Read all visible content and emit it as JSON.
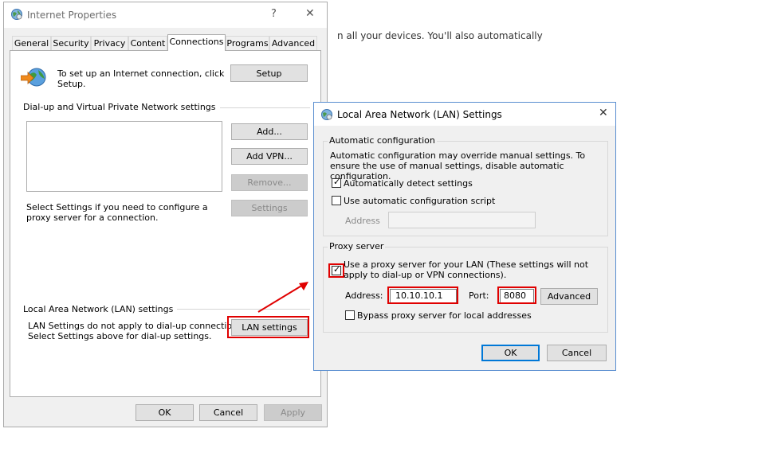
{
  "background": {
    "snippet": "n all your devices. You'll also automatically"
  },
  "internet_properties": {
    "title": "Internet Properties",
    "help_glyph": "?",
    "close_glyph": "✕",
    "tabs": [
      "General",
      "Security",
      "Privacy",
      "Content",
      "Connections",
      "Programs",
      "Advanced"
    ],
    "active_tab": "Connections",
    "setup_text": "To set up an Internet connection, click Setup.",
    "setup_button": "Setup",
    "dialup_group_label": "Dial-up and Virtual Private Network settings",
    "add_button": "Add...",
    "add_vpn_button": "Add VPN...",
    "remove_button": "Remove...",
    "settings_button": "Settings",
    "proxy_hint": "Select Settings if you need to configure a proxy server for a connection.",
    "lan_group_label": "Local Area Network (LAN) settings",
    "lan_note_1": "LAN Settings do not apply to dial-up connections.",
    "lan_note_2": "Select Settings above for dial-up settings.",
    "lan_settings_button": "LAN settings",
    "ok_button": "OK",
    "cancel_button": "Cancel",
    "apply_button": "Apply"
  },
  "lan_dialog": {
    "title": "Local Area Network (LAN) Settings",
    "close_glyph": "✕",
    "auto_config_legend": "Automatic configuration",
    "auto_config_desc": "Automatic configuration may override manual settings.  To ensure the use of manual settings, disable automatic configuration.",
    "auto_detect_label": "Automatically detect settings",
    "auto_detect_checked": true,
    "auto_script_label": "Use automatic configuration script",
    "auto_script_checked": false,
    "script_address_label": "Address",
    "script_address_value": "",
    "proxy_legend": "Proxy server",
    "use_proxy_label": "Use a proxy server for your LAN (These settings will not apply to dial-up or VPN connections).",
    "use_proxy_checked": true,
    "address_label": "Address:",
    "address_value": "10.10.10.1",
    "port_label": "Port:",
    "port_value": "8080",
    "advanced_button": "Advanced",
    "bypass_label": "Bypass proxy server for local addresses",
    "bypass_checked": false,
    "ok_button": "OK",
    "cancel_button": "Cancel"
  },
  "colors": {
    "highlight": "#e00000",
    "accent": "#0078d7"
  },
  "check_glyph": "✓"
}
